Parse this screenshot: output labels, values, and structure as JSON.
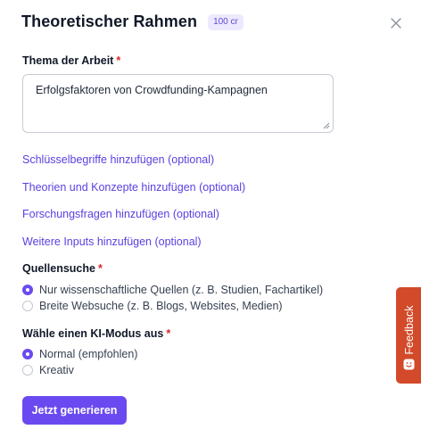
{
  "header": {
    "title": "Theoretischer Rahmen",
    "credits_badge": "100 cr"
  },
  "icons": {
    "close": "close-icon",
    "feedback": "feedback-smile-icon",
    "resize": "resize-grip-icon"
  },
  "colors": {
    "accent": "#6a4af0",
    "required": "#dc2626",
    "feedback_tab": "#d24a2a"
  },
  "topic": {
    "label": "Thema der Arbeit",
    "required_mark": "*",
    "value": "Erfolgsfaktoren von Crowdfunding-Kampagnen"
  },
  "optional_links": [
    {
      "label": "Schlüsselbegriffe hinzufügen (optional)"
    },
    {
      "label": "Theorien und Konzepte hinzufügen (optional)"
    },
    {
      "label": "Forschungsfragen hinzufügen (optional)"
    },
    {
      "label": "Weitere Inputs hinzufügen (optional)"
    }
  ],
  "source_search": {
    "label": "Quellensuche",
    "required_mark": "*",
    "options": [
      {
        "label": "Nur wissenschaftliche Quellen (z. B. Studien, Fachartikel)",
        "selected": true
      },
      {
        "label": "Breite Websuche (z. B. Blogs, Websites, Medien)",
        "selected": false
      }
    ]
  },
  "ai_mode": {
    "label": "Wähle einen KI-Modus aus",
    "required_mark": "*",
    "options": [
      {
        "label": "Normal (empfohlen)",
        "selected": true
      },
      {
        "label": "Kreativ",
        "selected": false
      }
    ]
  },
  "actions": {
    "generate_label": "Jetzt generieren"
  },
  "feedback_tab": {
    "label": "Feedback"
  }
}
